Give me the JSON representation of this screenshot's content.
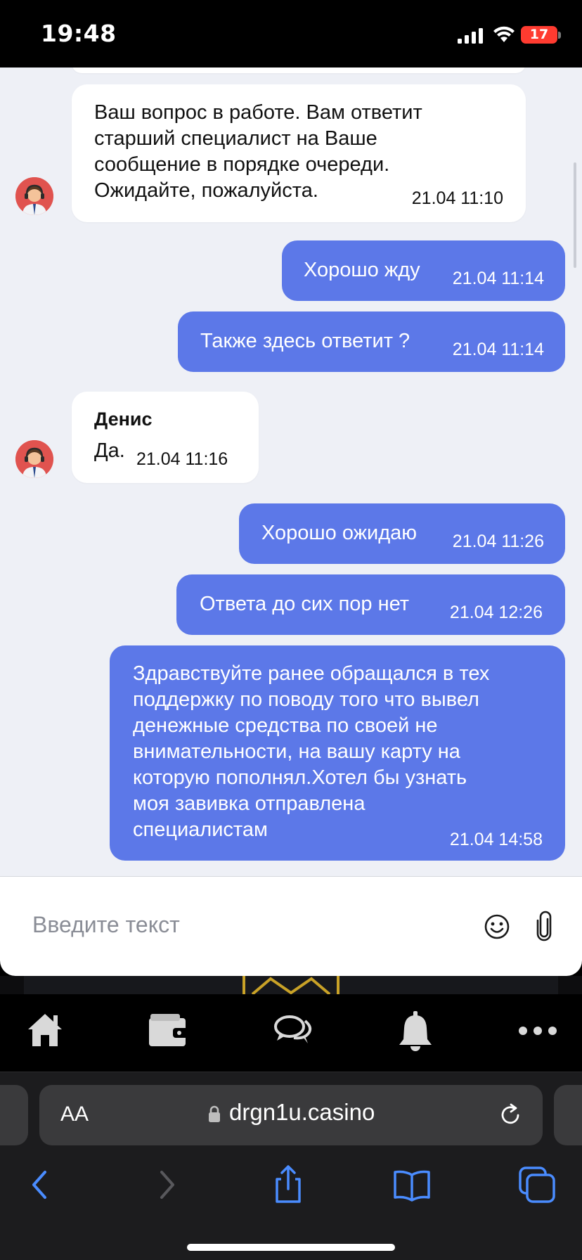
{
  "status_bar": {
    "time": "19:48",
    "battery": "17",
    "battery_color": "#ff3b30"
  },
  "chat": {
    "messages": [
      {
        "direction": "incoming",
        "author": "",
        "text": "Ваш вопрос в работе. Вам ответит\nстарший специалист на Ваше\nсообщение в порядке очереди.\nОжидайте, пожалуйста.",
        "time": "21.04 11:10"
      },
      {
        "direction": "outgoing",
        "text": "Хорошо жду",
        "time": "21.04 11:14"
      },
      {
        "direction": "outgoing",
        "text": "Также здесь ответит ?",
        "time": "21.04 11:14"
      },
      {
        "direction": "incoming",
        "author": "Денис",
        "text": "Да.",
        "time": "21.04 11:16"
      },
      {
        "direction": "outgoing",
        "text": "Хорошо ожидаю",
        "time": "21.04 11:26"
      },
      {
        "direction": "outgoing",
        "text": "Ответа до сих пор нет",
        "time": "21.04 12:26"
      },
      {
        "direction": "outgoing",
        "text": "Здравствуйте ранее обращался в тех\nподдержку по поводу того что вывел\nденежные средства по своей не\nвнимательности, на вашу карту на\nкоторую пополнял.Хотел бы узнать\nмоя завивка отправлена\nспециалистам",
        "time": "21.04 14:58"
      }
    ],
    "incoming_color": "#ffffff",
    "outgoing_color": "#5c78e8"
  },
  "input": {
    "placeholder": "Введите текст",
    "icons": [
      "emoji-icon",
      "paperclip-icon"
    ]
  },
  "site_nav": {
    "items": [
      "home-icon",
      "wallet-icon",
      "chat-icon",
      "bell-icon",
      "more-icon"
    ],
    "accent": "#c9a227"
  },
  "browser": {
    "text_size_label": "AA",
    "url": "drgn1u.casino",
    "toolbar": [
      "back-icon",
      "forward-icon",
      "share-icon",
      "bookmarks-icon",
      "tabs-icon"
    ],
    "accent": "#4a8cff"
  }
}
